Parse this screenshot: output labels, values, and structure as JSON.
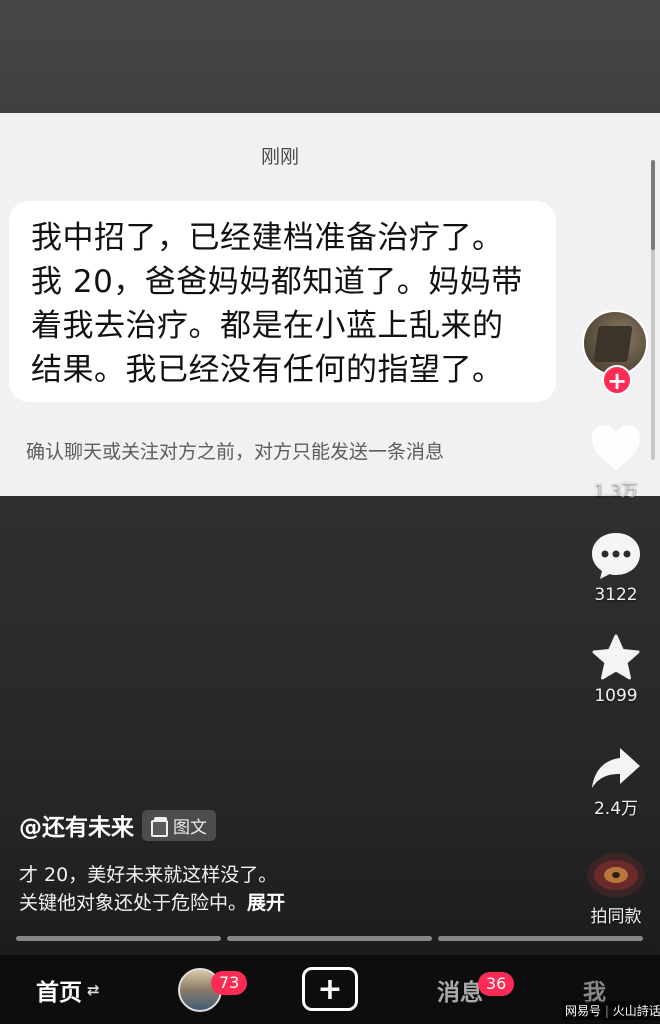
{
  "chat": {
    "time": "刚刚",
    "message_lines": [
      "我中招了，已经建档准备治疗了。",
      "我 20，爸爸妈妈都知道了。妈妈带",
      "着我去治疗。都是在小蓝上乱来的",
      "结果。我已经没有任何的指望了。"
    ],
    "notice": "确认聊天或关注对方之前，对方只能发送一条消息"
  },
  "rail": {
    "like_count": "1.3万",
    "comment_count": "3122",
    "favorite_count": "1099",
    "share_count": "2.4万",
    "music_label": "拍同款",
    "follow_icon": "plus-icon"
  },
  "post": {
    "author": "@还有未来",
    "tag": "图文",
    "desc_lines": [
      "才 20，美好未来就这样没了。",
      "关键他对象还处于危险中。"
    ],
    "expand": "展开"
  },
  "nav": {
    "home": "首页",
    "home_swap": "⇄",
    "friend_badge": "73",
    "plus": "+",
    "messages": "消息",
    "messages_badge": "36",
    "me": "我"
  },
  "watermark": {
    "left": "网易号",
    "right": "火山詩话"
  },
  "colors": {
    "accent": "#fe2c55",
    "chat_bg": "#f1f1f1",
    "bubble_bg": "#ffffff"
  }
}
